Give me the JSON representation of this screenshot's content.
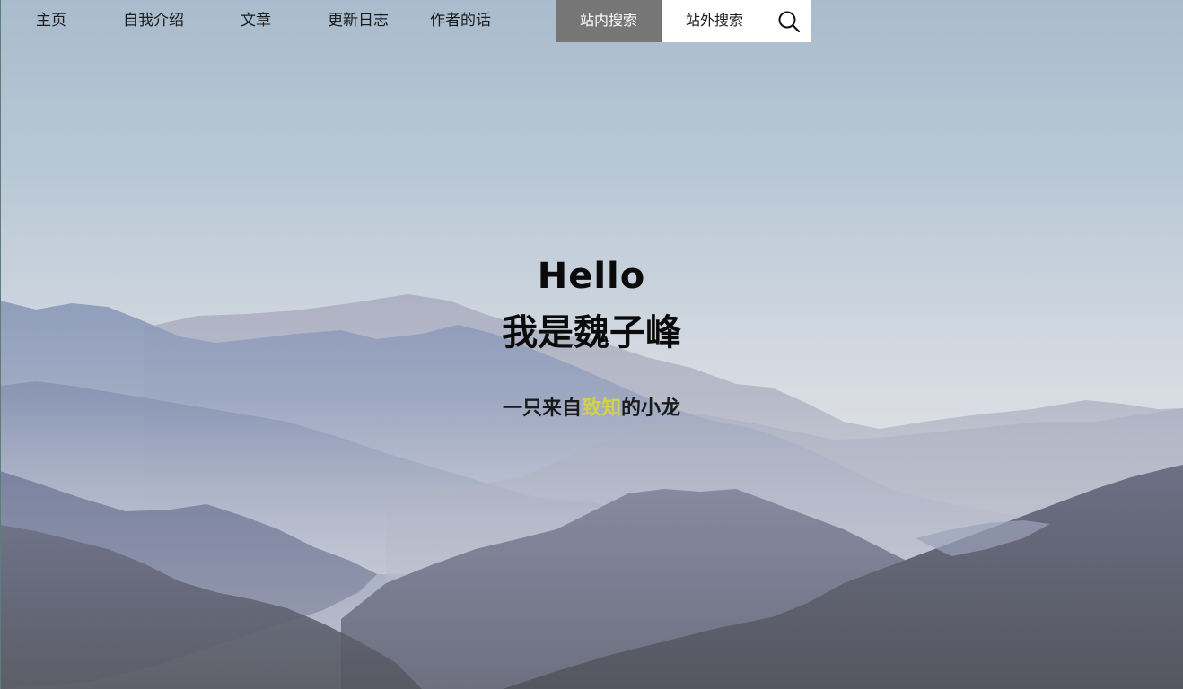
{
  "nav": {
    "items": [
      {
        "label": "主页"
      },
      {
        "label": "自我介绍"
      },
      {
        "label": "文章"
      },
      {
        "label": "更新日志"
      },
      {
        "label": "作者的话"
      }
    ]
  },
  "search": {
    "tab_internal": "站内搜索",
    "tab_external": "站外搜索",
    "icon": "search-icon"
  },
  "hero": {
    "greeting": "Hello",
    "name": "我是魏子峰",
    "tagline_before": "一只来自",
    "tagline_highlight": "致知",
    "tagline_after": "的小龙",
    "highlight_color": "#d3d246"
  },
  "theme": {
    "search_active_bg": "#767676",
    "search_bg": "#ffffff"
  }
}
